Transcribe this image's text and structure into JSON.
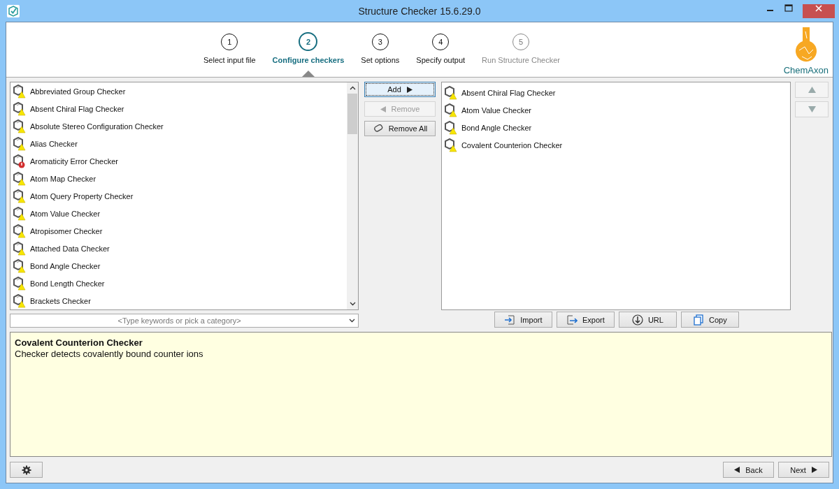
{
  "window": {
    "title": "Structure Checker 15.6.29.0"
  },
  "steps": [
    {
      "number": "1",
      "label": "Select input file",
      "selected": false,
      "disabled": false
    },
    {
      "number": "2",
      "label": "Configure checkers",
      "selected": true,
      "disabled": false
    },
    {
      "number": "3",
      "label": "Set options",
      "selected": false,
      "disabled": false
    },
    {
      "number": "4",
      "label": "Specify output",
      "selected": false,
      "disabled": false
    },
    {
      "number": "5",
      "label": "Run Structure Checker",
      "selected": false,
      "disabled": true
    }
  ],
  "logo": {
    "text": "ChemAxon"
  },
  "available_checkers": [
    {
      "label": "Abbreviated Group Checker",
      "kind": "warning"
    },
    {
      "label": "Absent Chiral Flag Checker",
      "kind": "warning"
    },
    {
      "label": "Absolute Stereo Configuration Checker",
      "kind": "warning"
    },
    {
      "label": "Alias Checker",
      "kind": "warning"
    },
    {
      "label": "Aromaticity Error Checker",
      "kind": "error"
    },
    {
      "label": "Atom Map Checker",
      "kind": "warning"
    },
    {
      "label": "Atom Query Property Checker",
      "kind": "warning"
    },
    {
      "label": "Atom Value Checker",
      "kind": "warning"
    },
    {
      "label": "Atropisomer Checker",
      "kind": "warning"
    },
    {
      "label": "Attached Data Checker",
      "kind": "warning"
    },
    {
      "label": "Bond Angle Checker",
      "kind": "warning"
    },
    {
      "label": "Bond Length Checker",
      "kind": "warning"
    },
    {
      "label": "Brackets Checker",
      "kind": "warning"
    }
  ],
  "search": {
    "placeholder": "<Type keywords or pick a category>"
  },
  "transfer_buttons": [
    {
      "label": "Add",
      "kind": "add",
      "disabled": false
    },
    {
      "label": "Remove",
      "kind": "remove",
      "disabled": true
    },
    {
      "label": "Remove All",
      "kind": "remove-all",
      "disabled": false
    }
  ],
  "selected_checkers": [
    {
      "label": "Absent Chiral Flag Checker",
      "kind": "warning"
    },
    {
      "label": "Atom Value Checker",
      "kind": "warning"
    },
    {
      "label": "Bond Angle Checker",
      "kind": "warning"
    },
    {
      "label": "Covalent Counterion Checker",
      "kind": "warning"
    }
  ],
  "order_buttons": [
    {
      "kind": "up",
      "disabled": true
    },
    {
      "kind": "down",
      "disabled": true
    }
  ],
  "list_buttons": [
    {
      "label": "Import",
      "kind": "import"
    },
    {
      "label": "Export",
      "kind": "export"
    },
    {
      "label": "URL",
      "kind": "url"
    },
    {
      "label": "Copy",
      "kind": "copy"
    }
  ],
  "description": {
    "title": "Covalent Counterion Checker",
    "text": "Checker detects covalently bound counter ions"
  },
  "footer": {
    "back": "Back",
    "next": "Next"
  }
}
